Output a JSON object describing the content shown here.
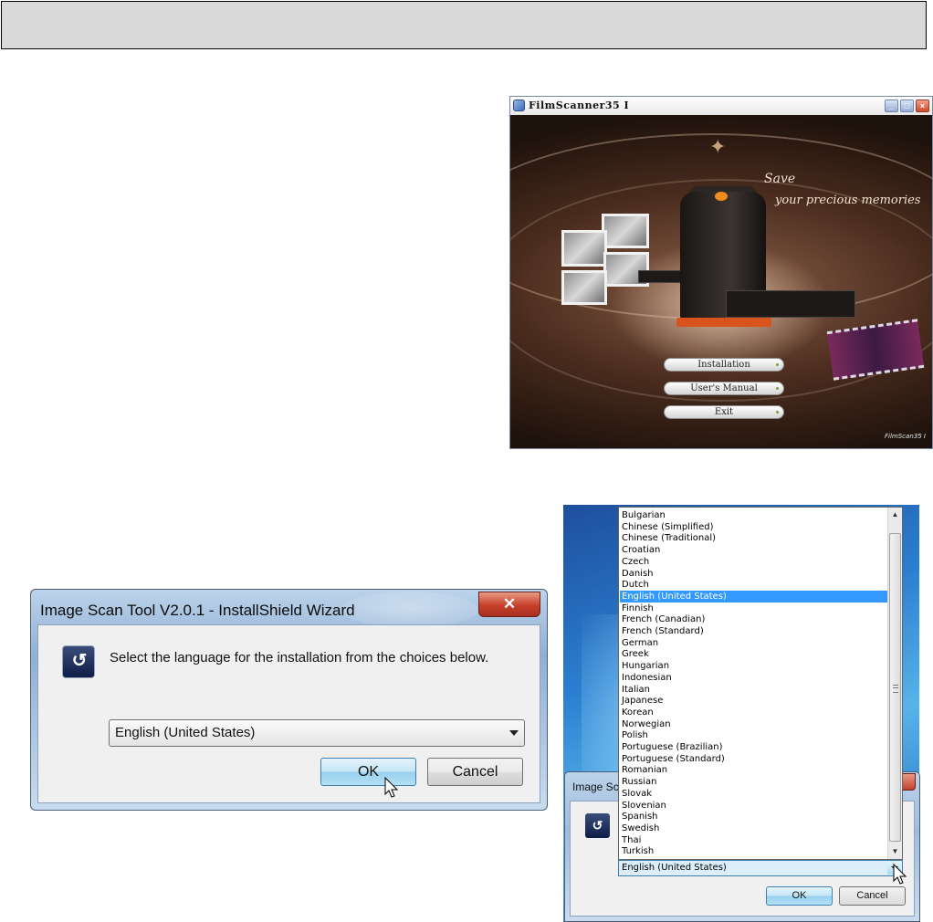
{
  "filmscanner": {
    "title": "FilmScanner35 I",
    "slogan_line1": "Save",
    "slogan_line2": "your precious memories",
    "buttons": {
      "installation": "Installation",
      "users_manual": "User's Manual",
      "exit": "Exit"
    },
    "logo_text": "FilmScan35 I"
  },
  "wizard": {
    "title": "Image Scan Tool V2.0.1 - InstallShield Wizard",
    "close_glyph": "✕",
    "prompt": "Select the language for the installation from the choices below.",
    "selected_language": "English (United States)",
    "ok_label": "OK",
    "cancel_label": "Cancel"
  },
  "dialog2": {
    "title_partial": "Image Sca",
    "ok_label": "OK",
    "cancel_label": "Cancel",
    "selected_language": "English (United States)",
    "languages": [
      "Bulgarian",
      "Chinese (Simplified)",
      "Chinese (Traditional)",
      "Croatian",
      "Czech",
      "Danish",
      "Dutch",
      "English (United States)",
      "Finnish",
      "French (Canadian)",
      "French (Standard)",
      "German",
      "Greek",
      "Hungarian",
      "Indonesian",
      "Italian",
      "Japanese",
      "Korean",
      "Norwegian",
      "Polish",
      "Portuguese (Brazilian)",
      "Portuguese (Standard)",
      "Romanian",
      "Russian",
      "Slovak",
      "Slovenian",
      "Spanish",
      "Swedish",
      "Thai",
      "Turkish"
    ],
    "highlighted_index": 7
  },
  "colors": {
    "selection": "#3399ff",
    "close_red": "#c6402a",
    "scanner_accent": "#d8541c"
  }
}
